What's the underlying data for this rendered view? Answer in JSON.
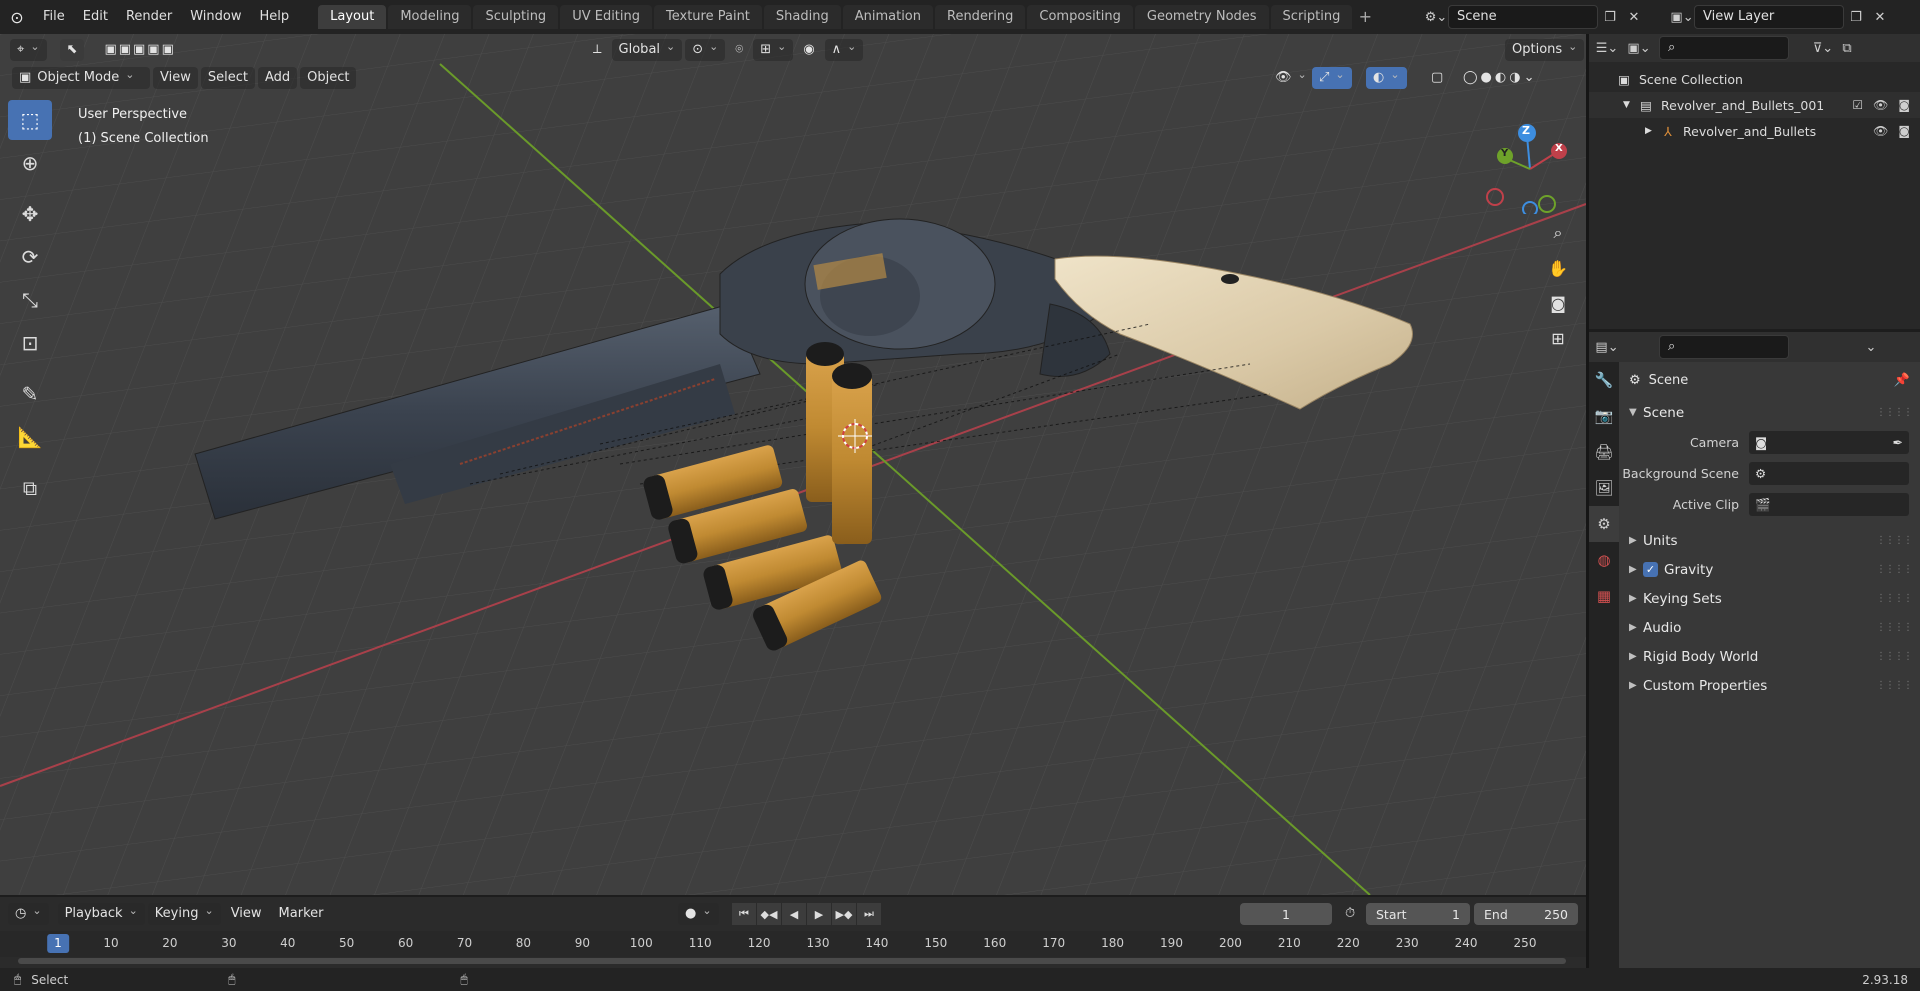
{
  "menu": [
    "File",
    "Edit",
    "Render",
    "Window",
    "Help"
  ],
  "workspaces": [
    "Layout",
    "Modeling",
    "Sculpting",
    "UV Editing",
    "Texture Paint",
    "Shading",
    "Animation",
    "Rendering",
    "Compositing",
    "Geometry Nodes",
    "Scripting"
  ],
  "active_workspace": "Layout",
  "scene_name": "Scene",
  "view_layer": "View Layer",
  "header": {
    "orientation": "Global",
    "options": "Options",
    "mode": "Object Mode",
    "view": "View",
    "select": "Select",
    "add": "Add",
    "object": "Object"
  },
  "overlay": {
    "perspective": "User Perspective",
    "collection": "(1) Scene Collection"
  },
  "gizmo": {
    "x": "X",
    "y": "Y",
    "z": "Z"
  },
  "outliner": {
    "root": "Scene Collection",
    "collection": "Revolver_and_Bullets_001",
    "object": "Revolver_and_Bullets"
  },
  "properties": {
    "title": "Scene",
    "panel": "Scene",
    "camera_label": "Camera",
    "bg_scene_label": "Background Scene",
    "active_clip_label": "Active Clip",
    "panels": [
      "Units",
      "Gravity",
      "Keying Sets",
      "Audio",
      "Rigid Body World",
      "Custom Properties"
    ]
  },
  "timeline": {
    "playback": "Playback",
    "keying": "Keying",
    "view": "View",
    "marker": "Marker",
    "current_frame": "1",
    "start_label": "Start",
    "start": "1",
    "end_label": "End",
    "end": "250",
    "ticks": [
      "1",
      "10",
      "20",
      "30",
      "40",
      "50",
      "60",
      "70",
      "80",
      "90",
      "100",
      "110",
      "120",
      "130",
      "140",
      "150",
      "160",
      "170",
      "180",
      "190",
      "200",
      "210",
      "220",
      "230",
      "240",
      "250"
    ]
  },
  "status": {
    "select": "Select",
    "version": "2.93.18"
  },
  "colors": {
    "accent": "#4772b3",
    "axis_x": "#c0404a",
    "axis_y": "#6ea22a",
    "axis_z": "#3d8ee0"
  }
}
